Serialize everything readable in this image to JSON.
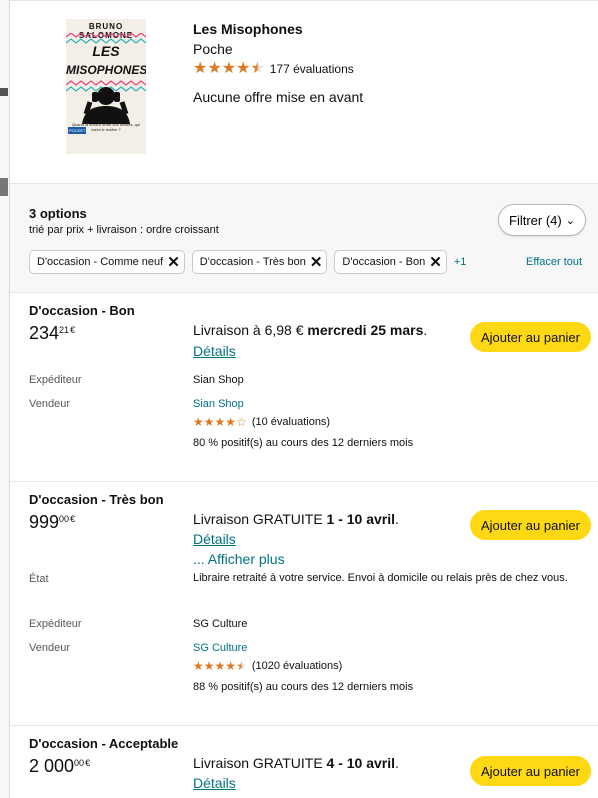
{
  "product": {
    "title": "Les Misophones",
    "format": "Poche",
    "rating_stars": 4.5,
    "rating_count": "177 évaluations",
    "no_offer": "Aucune offre mise en avant",
    "cover": {
      "author": "BRUNO SALOMONE",
      "title_line1": "LES",
      "title_line2": "MISOPHONES",
      "blurb": "Quand la terreur entre vos oreilles, qui tuera le maître ?",
      "publisher": "POCKET"
    }
  },
  "options": {
    "count": "3 options",
    "sort": "trié par prix + livraison : ordre croissant",
    "filter_button": "Filtrer (4)",
    "chips": [
      "D'occasion - Comme neuf",
      "D'occasion - Très bon",
      "D'occasion - Bon"
    ],
    "chips_more": "+1",
    "clear_all": "Effacer tout"
  },
  "labels": {
    "shipper": "Expéditeur",
    "seller": "Vendeur",
    "state": "État",
    "details": "Détails",
    "add_to_cart": "Ajouter au panier",
    "show_more": "... Afficher plus"
  },
  "offers": [
    {
      "condition": "D'occasion - Bon",
      "price_whole": "234",
      "price_fraction": "21",
      "currency": "€",
      "delivery_prefix": "Livraison à 6,98 € ",
      "delivery_date": "mercredi 25 mars",
      "delivery_suffix": ".",
      "shipper": "Sian Shop",
      "seller": "Sian Shop",
      "seller_stars": 4,
      "seller_reviews": "(10 évaluations)",
      "positive": "80 % positif(s) au cours des 12 derniers mois"
    },
    {
      "condition": "D'occasion - Très bon",
      "price_whole": "999",
      "price_fraction": "00",
      "currency": "€",
      "delivery_prefix": "Livraison GRATUITE ",
      "delivery_date": "1 - 10 avril",
      "delivery_suffix": ".",
      "state_note": "Libraire retraité à votre service. Envoi à domicile ou relais près de chez vous.",
      "shipper": "SG Culture",
      "seller": "SG Culture",
      "seller_stars": 4.5,
      "seller_reviews": "(1020 évaluations)",
      "positive": "88 % positif(s) au cours des 12 derniers mois"
    },
    {
      "condition": "D'occasion - Acceptable",
      "price_whole": "2 000",
      "price_fraction": "00",
      "currency": "€",
      "delivery_prefix": "Livraison GRATUITE ",
      "delivery_date": "4 - 10 avril",
      "delivery_suffix": "."
    }
  ],
  "colors": {
    "accent_link": "#007185",
    "star": "#de7921",
    "cart_button": "#ffd814"
  }
}
